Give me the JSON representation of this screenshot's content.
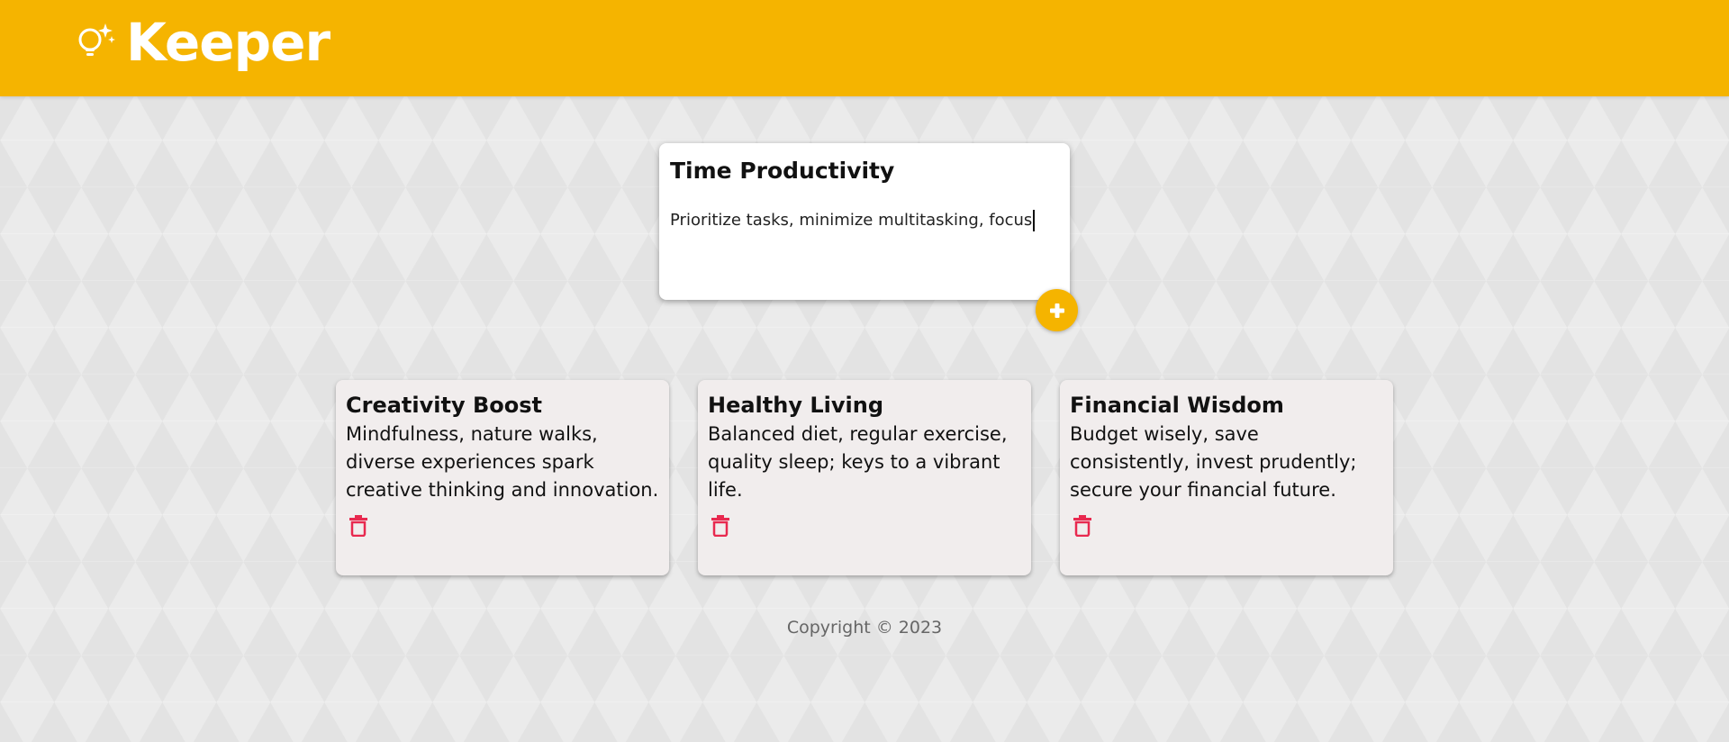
{
  "header": {
    "brand": "Keeper",
    "brand_color": "#f5b400",
    "logo_icon": "lightbulb-sparkle-icon"
  },
  "create_note": {
    "title_value": "Time Productivity",
    "content_value": "Prioritize tasks, minimize multitasking, focus",
    "add_icon": "plus-icon"
  },
  "notes": [
    {
      "title": "Creativity Boost",
      "content": "Mindfulness, nature walks, diverse experiences spark creative thinking and innovation.",
      "delete_icon": "trash-icon"
    },
    {
      "title": "Healthy Living",
      "content": "Balanced diet, regular exercise, quality sleep; keys to a vibrant life.",
      "delete_icon": "trash-icon"
    },
    {
      "title": "Financial Wisdom",
      "content": "Budget wisely, save consistently, invest prudently; secure your financial future.",
      "delete_icon": "trash-icon"
    }
  ],
  "footer": {
    "copyright": "Copyright © 2023"
  },
  "colors": {
    "accent": "#f5b400",
    "delete": "#e8294f",
    "note_background": "#f1eded"
  }
}
